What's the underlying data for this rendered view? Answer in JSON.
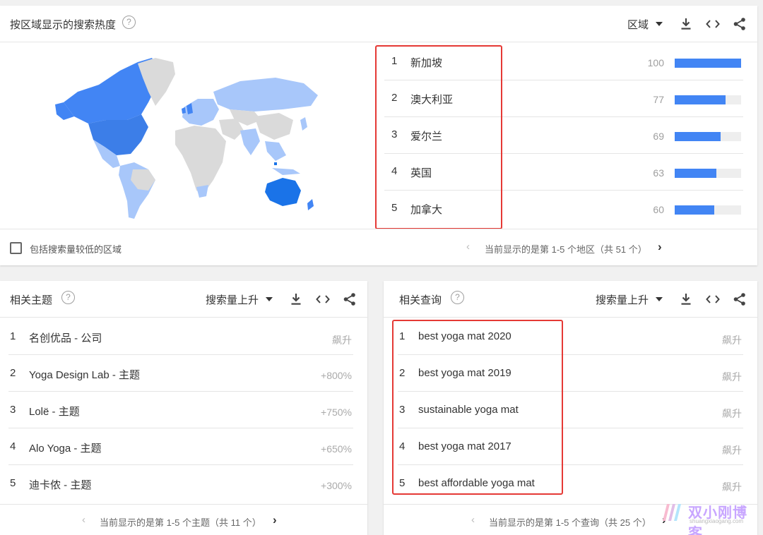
{
  "region_card": {
    "title": "按区域显示的搜索热度",
    "help": "?",
    "dropdown": "区域",
    "rows": [
      {
        "rank": "1",
        "name": "新加坡",
        "value": 100
      },
      {
        "rank": "2",
        "name": "澳大利亚",
        "value": 77
      },
      {
        "rank": "3",
        "name": "爱尔兰",
        "value": 69
      },
      {
        "rank": "4",
        "name": "英国",
        "value": 63
      },
      {
        "rank": "5",
        "name": "加拿大",
        "value": 60
      }
    ],
    "checkbox_label": "包括搜索量较低的区域",
    "pager": "当前显示的是第 1-5 个地区（共 51 个）"
  },
  "topics_card": {
    "title": "相关主题",
    "help": "?",
    "dropdown": "搜索量上升",
    "rows": [
      {
        "rank": "1",
        "text": "名创优品 - 公司",
        "value": "飙升"
      },
      {
        "rank": "2",
        "text": "Yoga Design Lab - 主题",
        "value": "+800%"
      },
      {
        "rank": "3",
        "text": "Lolë - 主题",
        "value": "+750%"
      },
      {
        "rank": "4",
        "text": "Alo Yoga - 主题",
        "value": "+650%"
      },
      {
        "rank": "5",
        "text": "迪卡侬 - 主题",
        "value": "+300%"
      }
    ],
    "pager": "当前显示的是第 1-5 个主题（共 11 个）"
  },
  "queries_card": {
    "title": "相关查询",
    "help": "?",
    "dropdown": "搜索量上升",
    "rows": [
      {
        "rank": "1",
        "text": "best yoga mat 2020",
        "value": "飙升"
      },
      {
        "rank": "2",
        "text": "best yoga mat 2019",
        "value": "飙升"
      },
      {
        "rank": "3",
        "text": "sustainable yoga mat",
        "value": "飙升"
      },
      {
        "rank": "4",
        "text": "best yoga mat 2017",
        "value": "飙升"
      },
      {
        "rank": "5",
        "text": "best affordable yoga mat",
        "value": "飙升"
      }
    ],
    "pager": "当前显示的是第 1-5 个查询（共 25 个）"
  },
  "icons": {
    "help": "help-circle-icon",
    "caret": "caret-down-icon",
    "download": "download-icon",
    "embed": "code-embed-icon",
    "share": "share-icon",
    "prev": "chevron-left-icon",
    "next": "chevron-right-icon"
  },
  "watermark": {
    "text": "双小刚博客",
    "sub": "shuangxiaogang.com"
  },
  "colors": {
    "bar": "#4285f4",
    "highlight_box": "#e53935",
    "map_strong": "#1a73e8",
    "map_medium": "#4285f4",
    "map_light": "#a8c7fa",
    "map_none": "#dadada"
  }
}
